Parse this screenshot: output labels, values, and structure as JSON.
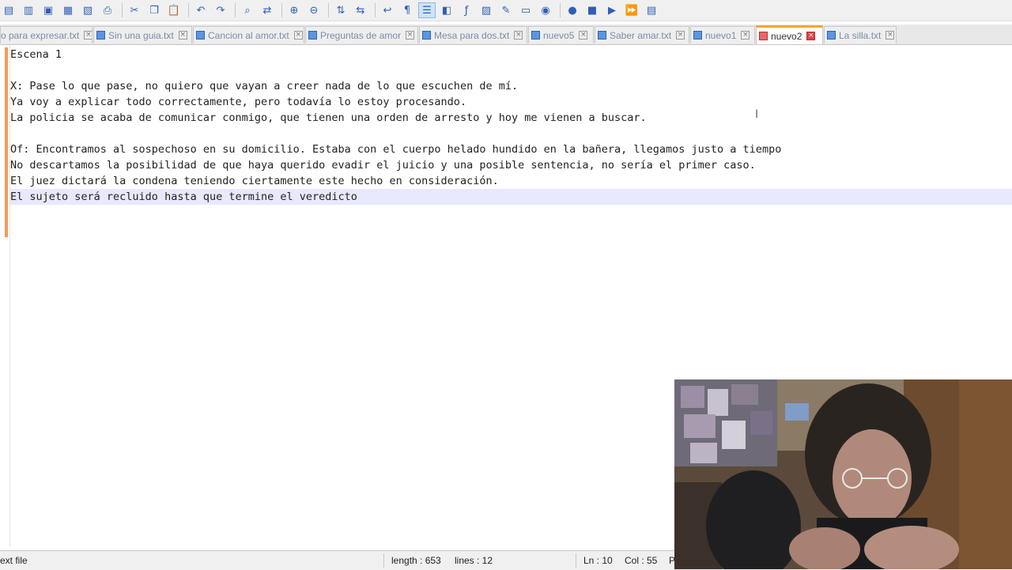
{
  "toolbar": {
    "buttons": [
      {
        "name": "new-file-icon",
        "glyph": "▤"
      },
      {
        "name": "open-file-icon",
        "glyph": "▥"
      },
      {
        "name": "save-icon",
        "glyph": "▣"
      },
      {
        "name": "save-all-icon",
        "glyph": "▦"
      },
      {
        "name": "close-icon",
        "glyph": "▧"
      },
      {
        "name": "print-icon",
        "glyph": "⎙"
      },
      {
        "sep": true
      },
      {
        "name": "cut-icon",
        "glyph": "✂"
      },
      {
        "name": "copy-icon",
        "glyph": "❐"
      },
      {
        "name": "paste-icon",
        "glyph": "📋"
      },
      {
        "sep": true
      },
      {
        "name": "undo-icon",
        "glyph": "↶"
      },
      {
        "name": "redo-icon",
        "glyph": "↷"
      },
      {
        "sep": true
      },
      {
        "name": "find-icon",
        "glyph": "⌕"
      },
      {
        "name": "replace-icon",
        "glyph": "⇄"
      },
      {
        "sep": true
      },
      {
        "name": "zoom-in-icon",
        "glyph": "⊕"
      },
      {
        "name": "zoom-out-icon",
        "glyph": "⊖"
      },
      {
        "sep": true
      },
      {
        "name": "sync-vertical-icon",
        "glyph": "⇅"
      },
      {
        "name": "sync-horizontal-icon",
        "glyph": "⇆"
      },
      {
        "sep": true
      },
      {
        "name": "word-wrap-icon",
        "glyph": "↩"
      },
      {
        "name": "show-all-characters-icon",
        "glyph": "¶"
      },
      {
        "name": "indent-guide-icon",
        "glyph": "☰",
        "active": true
      },
      {
        "name": "language-icon",
        "glyph": "◧"
      },
      {
        "name": "function-list-icon",
        "glyph": "ƒ"
      },
      {
        "name": "document-map-icon",
        "glyph": "▨"
      },
      {
        "name": "doc-list-icon",
        "glyph": "✎"
      },
      {
        "name": "folder-workspace-icon",
        "glyph": "▭"
      },
      {
        "name": "monitoring-icon",
        "glyph": "◉"
      },
      {
        "sep": true
      },
      {
        "name": "record-macro-icon",
        "glyph": "●"
      },
      {
        "name": "stop-macro-icon",
        "glyph": "■"
      },
      {
        "name": "play-macro-icon",
        "glyph": "▶"
      },
      {
        "name": "run-macro-multiple-icon",
        "glyph": "⏩"
      },
      {
        "name": "save-macro-icon",
        "glyph": "▤"
      }
    ]
  },
  "tabs": [
    {
      "label": "o para expresar.txt",
      "saved": true,
      "active": false
    },
    {
      "label": "Sin una guia.txt",
      "saved": true,
      "active": false
    },
    {
      "label": "Cancion al amor.txt",
      "saved": true,
      "active": false
    },
    {
      "label": "Preguntas de amor",
      "saved": true,
      "active": false
    },
    {
      "label": "Mesa para dos.txt",
      "saved": true,
      "active": false
    },
    {
      "label": "nuevo5",
      "saved": true,
      "active": false
    },
    {
      "label": "Saber amar.txt",
      "saved": true,
      "active": false
    },
    {
      "label": "nuevo1",
      "saved": true,
      "active": false
    },
    {
      "label": "nuevo2",
      "saved": false,
      "active": true
    },
    {
      "label": "La silla.txt",
      "saved": true,
      "active": false
    }
  ],
  "editor": {
    "lines": [
      "Escena 1",
      "",
      "X: Pase lo que pase, no quiero que vayan a creer nada de lo que escuchen de mí.",
      "Ya voy a explicar todo correctamente, pero todavía lo estoy procesando.",
      "La policia se acaba de comunicar conmigo, que tienen una orden de arresto y hoy me vienen a buscar.",
      "",
      "Of: Encontramos al sospechoso en su domicilio. Estaba con el cuerpo helado hundido en la bañera, llegamos justo a tiempo",
      "No descartamos la posibilidad de que haya querido evadir el juicio y una posible sentencia, no sería el primer caso.",
      "El juez dictará la condena teniendo ciertamente este hecho en consideración.",
      "El sujeto será recluido hasta que termine el veredicto"
    ],
    "current_line": 10
  },
  "status": {
    "file_type": "ext file",
    "length": "length : 653",
    "lines": "lines : 12",
    "ln": "Ln : 10",
    "col": "Col : 55",
    "pos": "P"
  }
}
